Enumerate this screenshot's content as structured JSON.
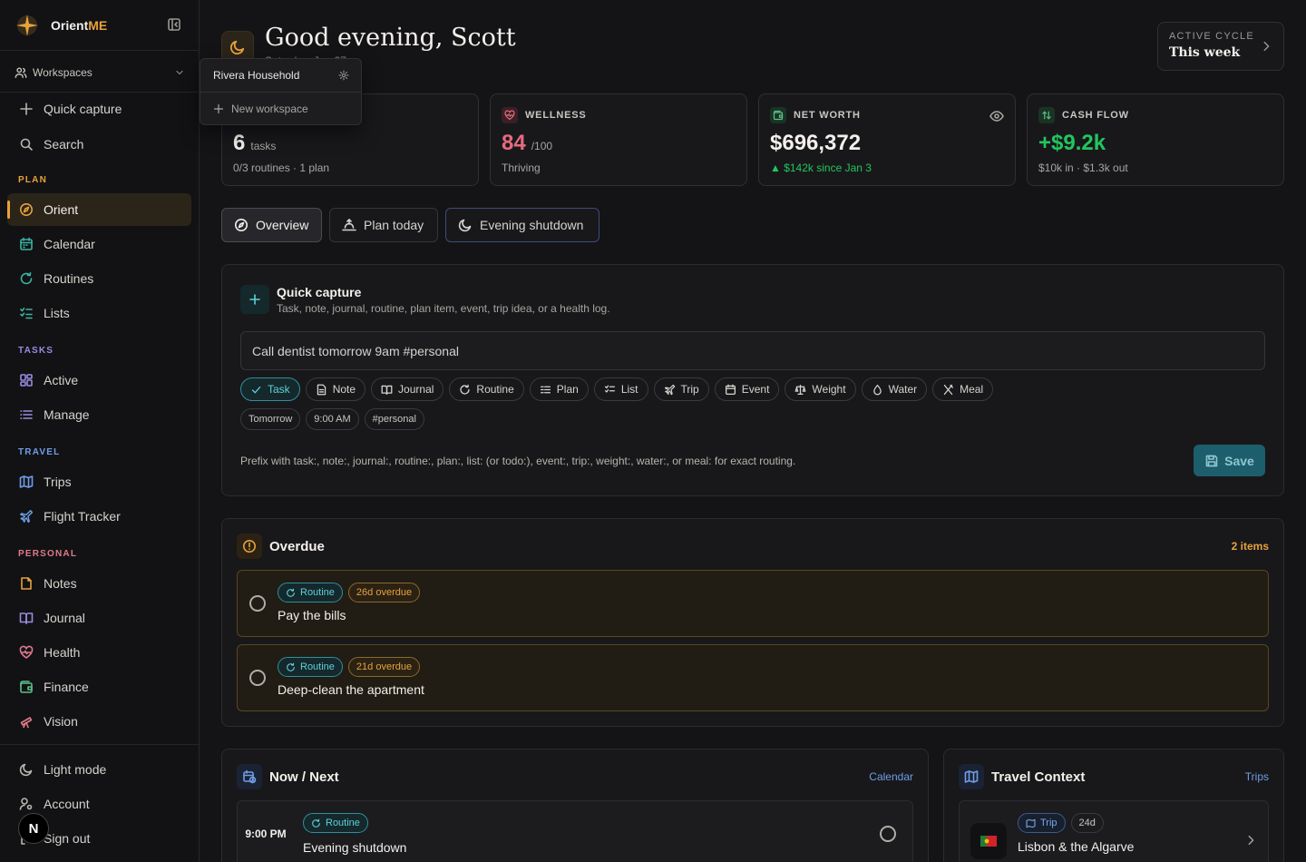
{
  "app": {
    "name_prefix": "Orient",
    "name_suffix": "ME"
  },
  "sidebar": {
    "workspaces_label": "Workspaces",
    "quick_capture": "Quick capture",
    "search": "Search",
    "sections": {
      "plan": "PLAN",
      "tasks": "TASKS",
      "travel": "TRAVEL",
      "personal": "PERSONAL"
    },
    "items": {
      "orient": "Orient",
      "calendar": "Calendar",
      "routines": "Routines",
      "lists": "Lists",
      "active": "Active",
      "manage": "Manage",
      "trips": "Trips",
      "flight_tracker": "Flight Tracker",
      "notes": "Notes",
      "journal": "Journal",
      "health": "Health",
      "finance": "Finance",
      "vision": "Vision"
    },
    "footer": {
      "light_mode": "Light mode",
      "account": "Account",
      "sign_out": "Sign out"
    },
    "next_badge": "N"
  },
  "workspace_menu": {
    "current": "Rivera Household",
    "new": "New workspace"
  },
  "header": {
    "greeting": "Good evening, Scott",
    "subtitle": "Saturday, Jan 27",
    "cycle_label": "ACTIVE CYCLE",
    "cycle_value": "This week"
  },
  "stats": {
    "today": {
      "value": "6",
      "unit": "tasks",
      "sub": "0/3 routines · 1 plan"
    },
    "wellness": {
      "label": "WELLNESS",
      "value": "84",
      "unit": "/100",
      "sub": "Thriving"
    },
    "net_worth": {
      "label": "NET WORTH",
      "value": "$696,372",
      "sub": "▲ $142k since Jan 3"
    },
    "cash_flow": {
      "label": "CASH FLOW",
      "value": "+$9.2k",
      "sub": "$10k in · $1.3k out"
    }
  },
  "tabs": {
    "overview": "Overview",
    "plan_today": "Plan today",
    "evening_shutdown": "Evening shutdown"
  },
  "quick_capture": {
    "title": "Quick capture",
    "description": "Task, note, journal, routine, plan item, event, trip idea, or a health log.",
    "input_value": "Call dentist tomorrow 9am #personal",
    "types": [
      "Task",
      "Note",
      "Journal",
      "Routine",
      "Plan",
      "List",
      "Trip",
      "Event",
      "Weight",
      "Water",
      "Meal"
    ],
    "tags": [
      "Tomorrow",
      "9:00 AM",
      "#personal"
    ],
    "hint": "Prefix with task:, note:, journal:, routine:, plan:, list: (or todo:), event:, trip:, weight:, water:, or meal: for exact routing.",
    "save": "Save"
  },
  "overdue": {
    "title": "Overdue",
    "count": "2 items",
    "items": [
      {
        "type": "Routine",
        "overdue": "26d overdue",
        "text": "Pay the bills"
      },
      {
        "type": "Routine",
        "overdue": "21d overdue",
        "text": "Deep-clean the apartment"
      }
    ]
  },
  "now_next": {
    "title": "Now / Next",
    "link": "Calendar",
    "item": {
      "time": "9:00 PM",
      "type": "Routine",
      "text": "Evening shutdown"
    }
  },
  "travel": {
    "title": "Travel Context",
    "link": "Trips",
    "item": {
      "type": "Trip",
      "days": "24d",
      "text": "Lisbon & the Algarve"
    }
  },
  "colors": {
    "accent": "#e6a23c",
    "teal": "#3bb3a4",
    "green": "#22c55e",
    "red": "#e56b7d",
    "blue": "#6f9ee8"
  }
}
